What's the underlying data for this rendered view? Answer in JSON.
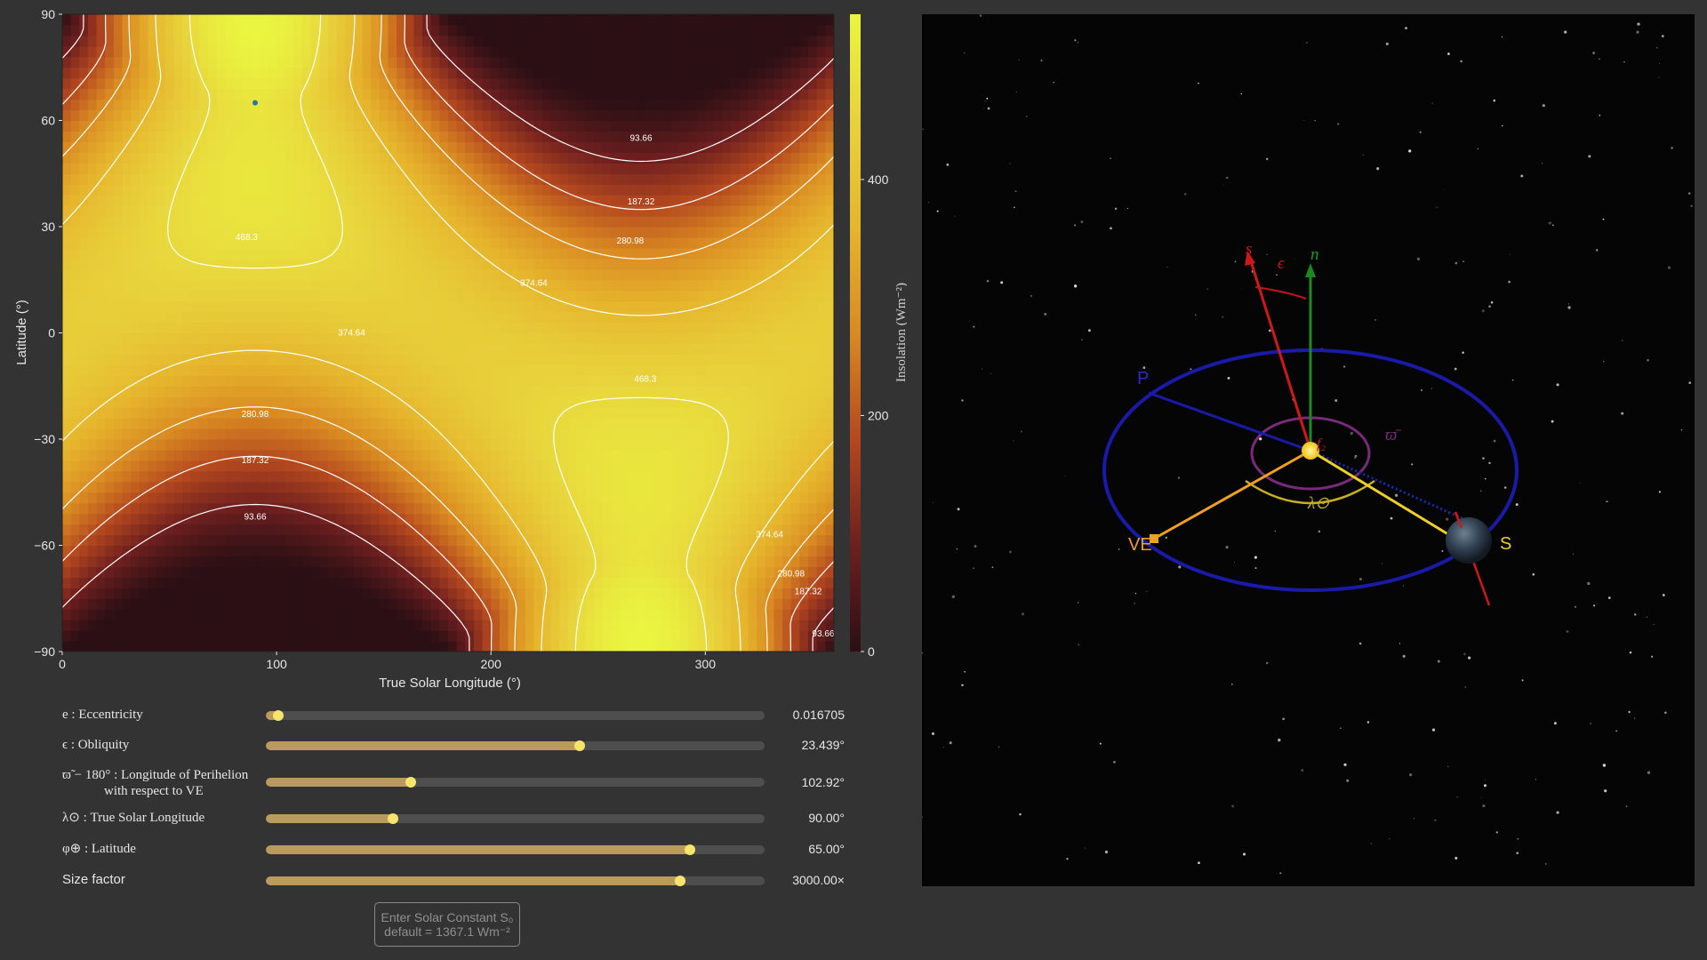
{
  "chart_data": {
    "type": "heatmap",
    "xlabel": "True Solar Longitude (°)",
    "ylabel": "Latitude (°)",
    "colorbar_label": "Insolation (Wm⁻²)",
    "xlim": [
      0,
      360
    ],
    "ylim": [
      -90,
      90
    ],
    "x_ticks": [
      "0",
      "100",
      "200",
      "300"
    ],
    "y_ticks": [
      "90",
      "60",
      "30",
      "0",
      "−30",
      "−60",
      "−90"
    ],
    "colorbar_ticks": [
      "400",
      "200",
      "0"
    ],
    "colorbar_range": [
      0,
      540
    ],
    "colormap": [
      "#2a0f14",
      "#6e1f1f",
      "#b4481f",
      "#d98a22",
      "#e6b52d",
      "#e8d23c",
      "#eaf540"
    ],
    "contour_levels": [
      "93.66",
      "187.32",
      "280.98",
      "374.64",
      "468.3"
    ],
    "marker": {
      "x": 90,
      "y": 65,
      "color": "#1f77b4"
    }
  },
  "controls": {
    "eccentricity": {
      "label": "e :  Eccentricity",
      "value": "0.016705",
      "fraction": 0.025
    },
    "obliquity": {
      "label": "ϵ :  Obliquity",
      "value": "23.439°",
      "fraction": 0.63
    },
    "perihelion": {
      "label_line1": "ϖ̃ − 180° :  Longitude of Perihelion",
      "label_line2": "with respect to VE",
      "value": "102.92°",
      "fraction": 0.29
    },
    "true_longitude": {
      "label": "λ⊙ :  True Solar Longitude",
      "value": "90.00°",
      "fraction": 0.255
    },
    "latitude": {
      "label": "φ⊕ :  Latitude",
      "value": "65.00°",
      "fraction": 0.85
    },
    "size_factor": {
      "label": "Size factor",
      "value": "3000.00×",
      "fraction": 0.83
    }
  },
  "solar_constant": {
    "line1": "Enter Solar Constant S₀",
    "line2": "default = 1367.1 Wm⁻²"
  },
  "orbit_view": {
    "labels": {
      "perihelion": "P",
      "vernal_equinox": "VE",
      "solstice": "S",
      "spin_axis": "s⃗",
      "orbit_normal": "n⃗",
      "obliquity": "ϵ",
      "perihelion_angle": "ϖ̄",
      "true_longitude": "λ⊙",
      "sun_label": "f₂"
    },
    "colors": {
      "orbit": "#1a1aa8",
      "spin_axis": "#d01818",
      "normal": "#1a8a1a",
      "vernal_equinox": "#f0a020",
      "solstice": "#f0d020",
      "perihelion_arc": "#7a2a7a",
      "sun": "#f5d020"
    }
  }
}
